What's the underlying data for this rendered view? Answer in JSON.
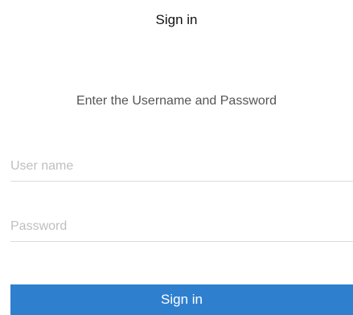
{
  "header": {
    "title": "Sign in"
  },
  "form": {
    "prompt": "Enter the Username and Password",
    "username": {
      "value": "",
      "placeholder": "User name"
    },
    "password": {
      "value": "",
      "placeholder": "Password"
    },
    "submit_label": "Sign in"
  },
  "colors": {
    "accent": "#2f7fcf",
    "placeholder": "#bfbfbf",
    "divider": "#dcdcdc"
  }
}
